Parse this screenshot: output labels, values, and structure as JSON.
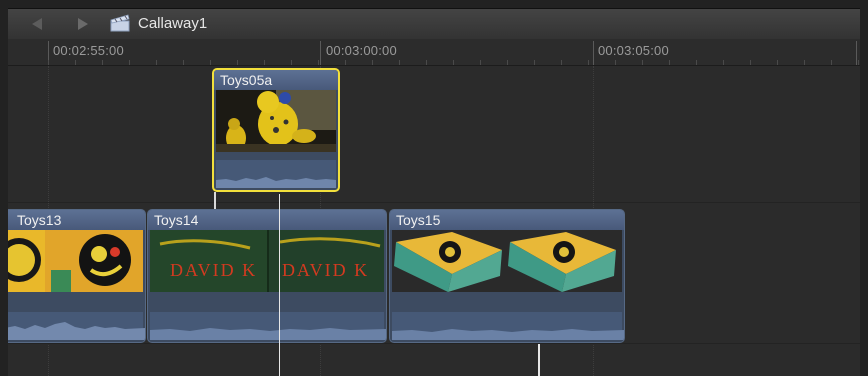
{
  "toolbar": {
    "back_icon": "back-arrow-icon",
    "forward_icon": "forward-arrow-icon",
    "project_icon": "clapperboard-icon",
    "project_name": "Callaway1"
  },
  "ruler": {
    "timecodes": [
      "00:02:55:00",
      "00:03:00:00",
      "00:03:05:00"
    ]
  },
  "clips": {
    "connected": {
      "name": "Toys05a",
      "selected": true
    },
    "primary": [
      {
        "name": "Toys13"
      },
      {
        "name": "Toys14"
      },
      {
        "name": "Toys15"
      }
    ]
  },
  "thumb_text": {
    "toys14": "DAVID K"
  },
  "colors": {
    "selection": "#f2e03c",
    "clip": "#3d4b61",
    "header": "#5d7194",
    "background": "#2b2b2b"
  }
}
